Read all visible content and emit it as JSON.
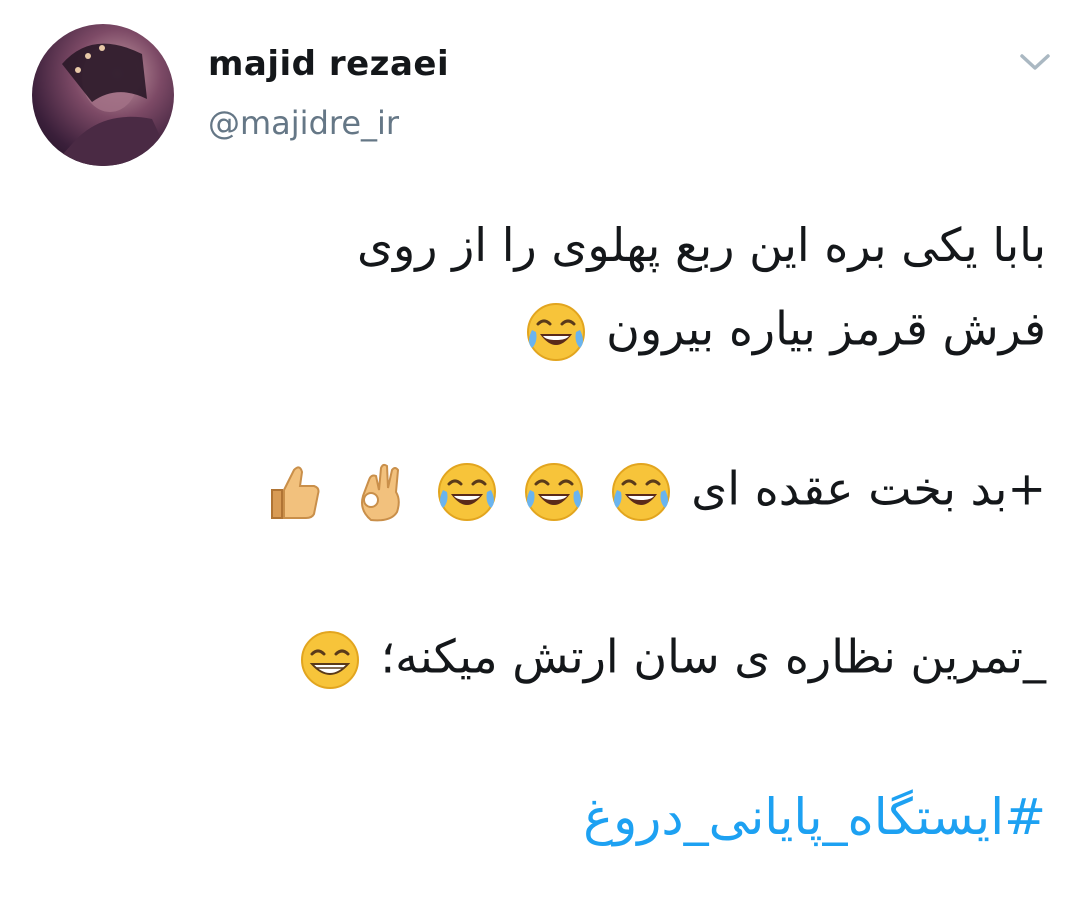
{
  "user": {
    "display_name": "majid rezaei",
    "handle": "@majidre_ir"
  },
  "menu": {
    "icon": "chevron-down-icon"
  },
  "tweet": {
    "line1": "بابا یکی بره این ربع پهلوی را از روی",
    "line2": "فرش قرمز بیاره بیرون",
    "line3": "+بد بخت عقده ای",
    "line4": "_تمرین نظاره ی سان ارتش میکنه؛",
    "hashtag": "#ایستگاه_پایانی_دروغ"
  },
  "colors": {
    "hashtag": "#1da1f2",
    "handle": "#657786",
    "text": "#14171a"
  },
  "emoji": {
    "line2": [
      "joy"
    ],
    "line3": [
      "joy",
      "joy",
      "joy",
      "ok-hand",
      "thumbs-up"
    ],
    "line4": [
      "grin"
    ]
  }
}
